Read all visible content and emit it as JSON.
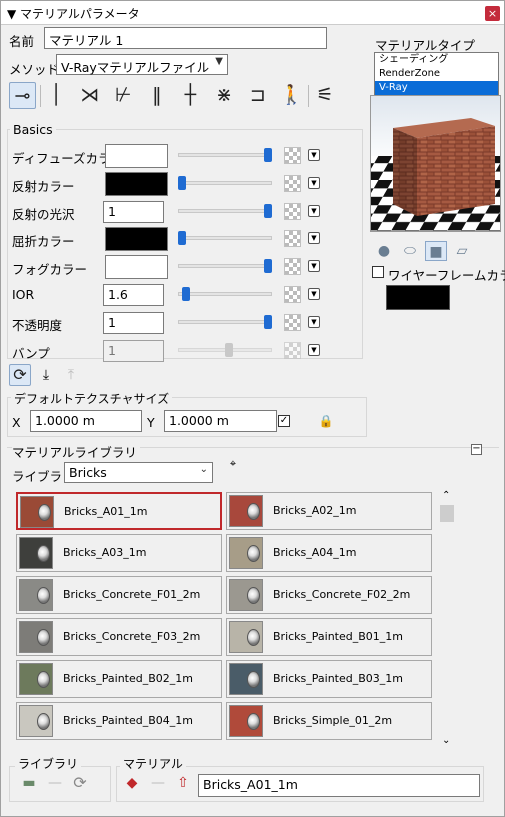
{
  "window": {
    "title": "▼ マテリアルパラメータ",
    "close_label": "×"
  },
  "name": {
    "label": "名前",
    "value": "マテリアル 1"
  },
  "method": {
    "label": "メソッド",
    "value": "V-Rayマテリアルファイル"
  },
  "material_type": {
    "label": "マテリアルタイプ",
    "items": [
      {
        "label": "シェーディング",
        "selected": false
      },
      {
        "label": "RenderZone",
        "selected": false
      },
      {
        "label": "V-Ray",
        "selected": true
      }
    ]
  },
  "toolbar": {
    "tools": [
      {
        "name": "tool-material-bar",
        "icon": "⊸",
        "selected": true
      },
      {
        "name": "tool-straight",
        "icon": "│",
        "selected": false
      },
      {
        "name": "tool-bend",
        "icon": "⋊",
        "selected": false
      },
      {
        "name": "tool-split",
        "icon": "⊬",
        "selected": false
      },
      {
        "name": "tool-double",
        "icon": "‖",
        "selected": false
      },
      {
        "name": "tool-cross",
        "icon": "┼",
        "selected": false
      },
      {
        "name": "tool-cross-split",
        "icon": "⋇",
        "selected": false
      },
      {
        "name": "tool-fork",
        "icon": "⊐",
        "selected": false
      },
      {
        "name": "tool-person",
        "icon": "🚶",
        "selected": false
      },
      {
        "name": "tool-settings",
        "icon": "⚟",
        "selected": false
      }
    ]
  },
  "basics": {
    "title": "Basics",
    "rows": [
      {
        "label": "ディフューズカラー",
        "kind": "color",
        "color": "#ffffff",
        "slider": 1.0
      },
      {
        "label": "反射カラー",
        "kind": "color",
        "color": "#000000",
        "slider": 0.0
      },
      {
        "label": "反射の光沢",
        "kind": "value",
        "value": "1",
        "slider": 1.0
      },
      {
        "label": "屈折カラー",
        "kind": "color",
        "color": "#000000",
        "slider": 0.0
      },
      {
        "label": "フォグカラー",
        "kind": "color",
        "color": "#ffffff",
        "slider": 1.0
      },
      {
        "label": "IOR",
        "kind": "value",
        "value": "1.6",
        "slider": 0.05
      },
      {
        "label": "不透明度",
        "kind": "value",
        "value": "1",
        "slider": 1.0
      },
      {
        "label": "バンプ",
        "kind": "value",
        "value": "1",
        "slider": 0.55,
        "disabled": true
      }
    ]
  },
  "preview": {
    "shapes": [
      "sphere-icon",
      "cylinder-icon",
      "cube-icon",
      "plane-icon"
    ],
    "selected_shape": "cube-icon",
    "wireframe_label": "ワイヤーフレームカラー",
    "wireframe_checked": false,
    "wireframe_color": "#000000"
  },
  "texture_size": {
    "title": "デフォルトテクスチャサイズ",
    "x_label": "X",
    "x_value": "1.0000 m",
    "y_label": "Y",
    "y_value": "1.0000 m",
    "linked": true
  },
  "library": {
    "title": "マテリアルライブラリ",
    "library_label": "ライブラリ:",
    "library_value": "Bricks",
    "items": [
      {
        "name": "Bricks_A01_1m",
        "color": "#9a4a36",
        "selected": true
      },
      {
        "name": "Bricks_A02_1m",
        "color": "#a8483c",
        "selected": false
      },
      {
        "name": "Bricks_A03_1m",
        "color": "#3e3f3c",
        "selected": false
      },
      {
        "name": "Bricks_A04_1m",
        "color": "#a79d88",
        "selected": false
      },
      {
        "name": "Bricks_Concrete_F01_2m",
        "color": "#8a8a86",
        "selected": false
      },
      {
        "name": "Bricks_Concrete_F02_2m",
        "color": "#9b9890",
        "selected": false
      },
      {
        "name": "Bricks_Concrete_F03_2m",
        "color": "#7d7c78",
        "selected": false
      },
      {
        "name": "Bricks_Painted_B01_1m",
        "color": "#b8b4a8",
        "selected": false
      },
      {
        "name": "Bricks_Painted_B02_1m",
        "color": "#6d7a5c",
        "selected": false
      },
      {
        "name": "Bricks_Painted_B03_1m",
        "color": "#4a5c68",
        "selected": false
      },
      {
        "name": "Bricks_Painted_B04_1m",
        "color": "#c9c7bf",
        "selected": false
      },
      {
        "name": "Bricks_Simple_01_2m",
        "color": "#b04a3a",
        "selected": false
      }
    ]
  },
  "footer": {
    "library_group": "ライブラリ",
    "material_group": "マテリアル",
    "material_value": "Bricks_A01_1m"
  }
}
